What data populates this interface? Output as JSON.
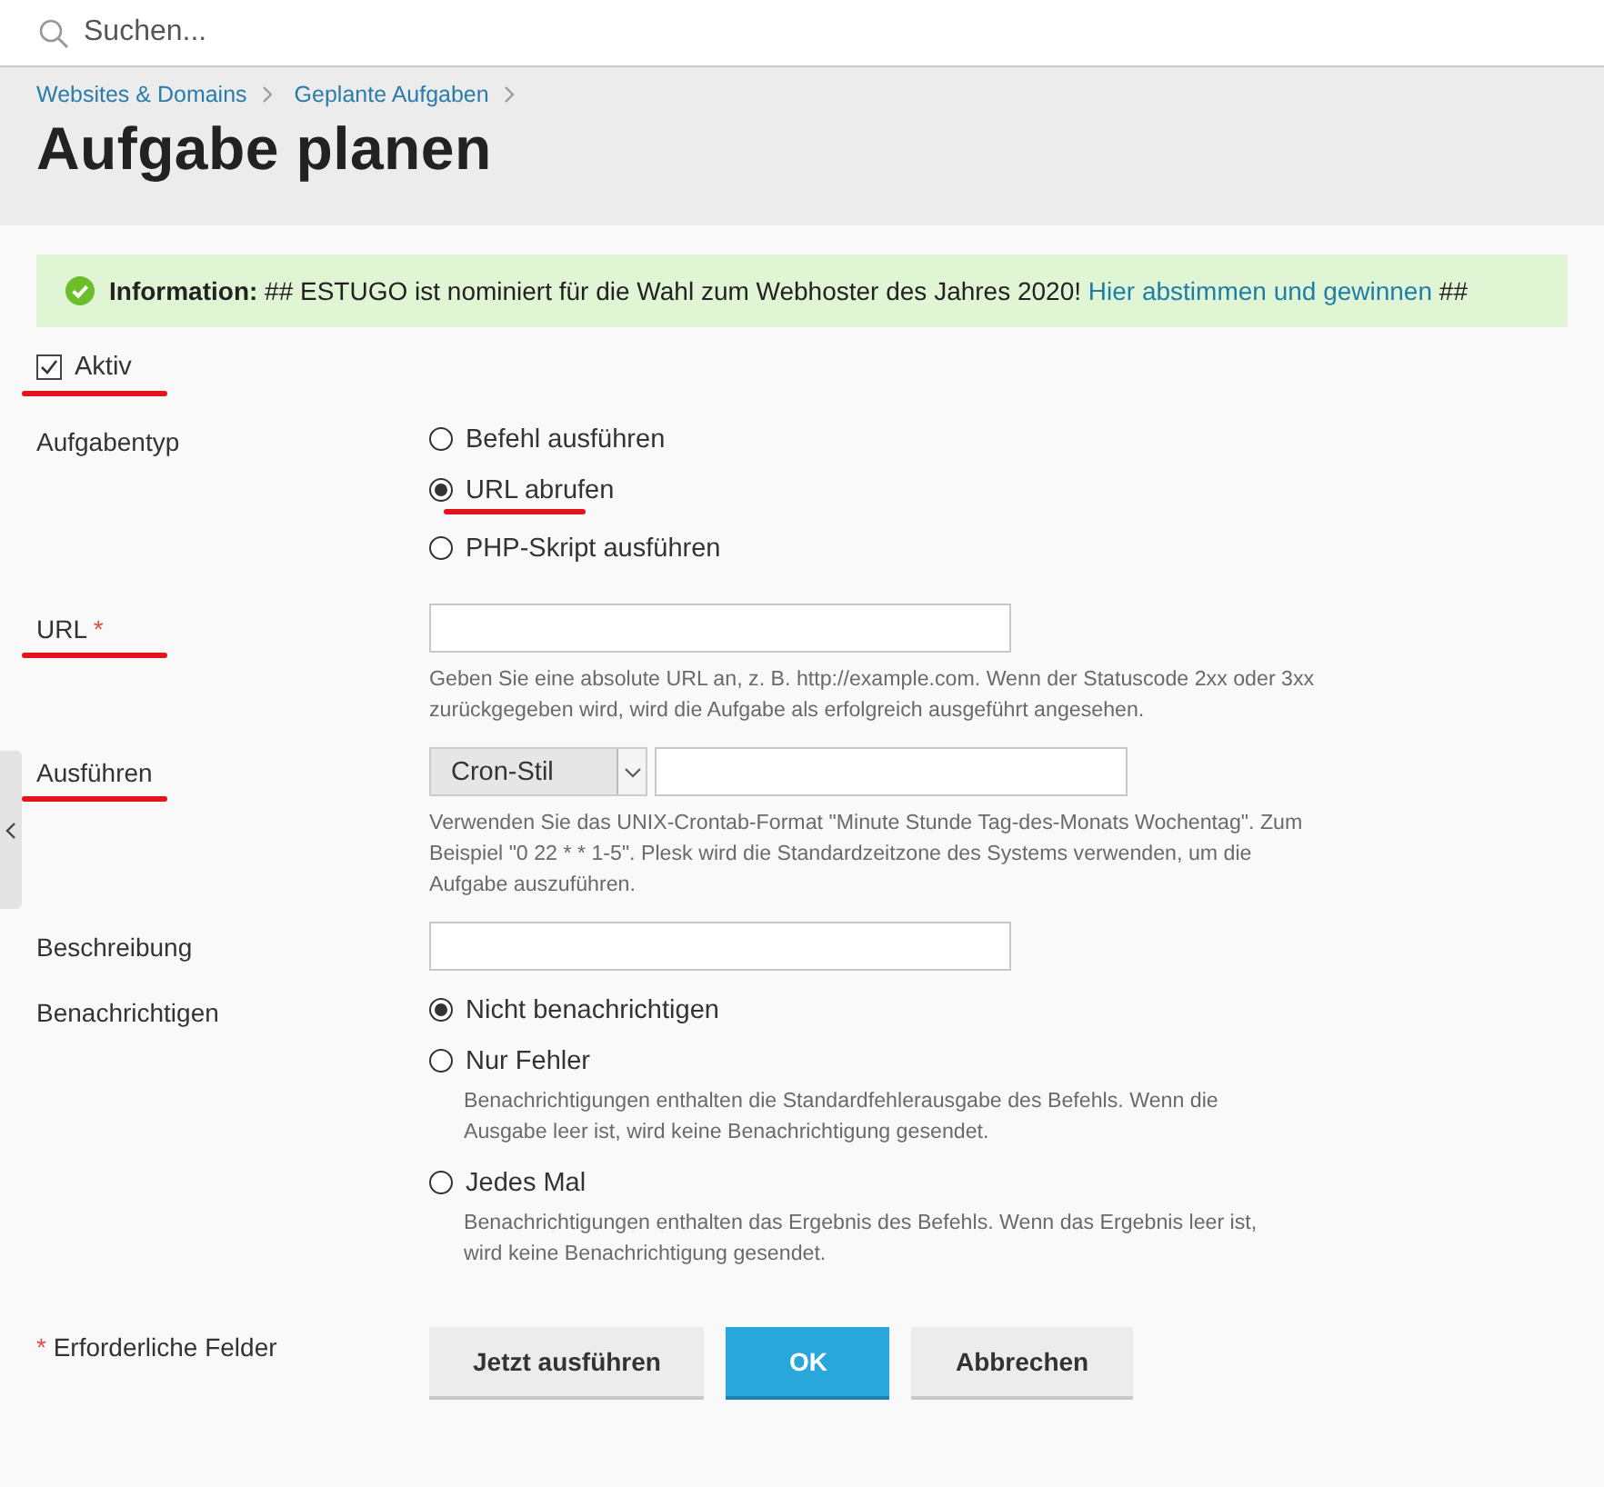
{
  "search": {
    "placeholder": "Suchen..."
  },
  "breadcrumbs": [
    "Websites & Domains",
    "Geplante Aufgaben"
  ],
  "title": "Aufgabe planen",
  "notice": {
    "label": "Information:",
    "text": "## ESTUGO ist nominiert für die Wahl zum Webhoster des Jahres 2020!",
    "link": "Hier abstimmen und gewinnen",
    "suffix": "##"
  },
  "active": {
    "label": "Aktiv",
    "checked": true,
    "underlined": true
  },
  "fields": [
    {
      "kind": "radio",
      "label": "Aufgabentyp",
      "underlined": false,
      "options": [
        {
          "label": "Befehl ausführen",
          "selected": false,
          "underlined": false
        },
        {
          "label": "URL abrufen",
          "selected": true,
          "underlined": true
        },
        {
          "label": "PHP-Skript ausführen",
          "selected": false,
          "underlined": false
        }
      ]
    },
    {
      "kind": "text",
      "label": "URL",
      "required_mark": "*",
      "underlined": true,
      "hint": "Geben Sie eine absolute URL an, z. B. http://example.com. Wenn der Statuscode 2xx oder 3xx zurückgegeben wird, wird die Aufgabe als erfolgreich ausgeführt angesehen."
    },
    {
      "kind": "schedule",
      "label": "Ausführen",
      "underlined": true,
      "select": "Cron-Stil",
      "hint": "Verwenden Sie das UNIX-Crontab-Format \"Minute Stunde Tag-des-Monats Wochentag\". Zum Beispiel \"0 22 * * 1-5\". Plesk wird die Standardzeitzone des Systems verwenden, um die Aufgabe auszuführen."
    },
    {
      "kind": "text",
      "label": "Beschreibung",
      "underlined": false
    },
    {
      "kind": "radio",
      "label": "Benachrichtigen",
      "underlined": false,
      "options": [
        {
          "label": "Nicht benachrichtigen",
          "selected": true,
          "underlined": false
        },
        {
          "label": "Nur Fehler",
          "selected": false,
          "underlined": false,
          "hint": "Benachrichtigungen enthalten die Standardfehlerausgabe des Befehls. Wenn die Ausgabe leer ist, wird keine Benachrichtigung gesendet."
        },
        {
          "label": "Jedes Mal",
          "selected": false,
          "underlined": false,
          "hint": "Benachrichtigungen enthalten das Ergebnis des Befehls. Wenn das Ergebnis leer ist, wird keine Benachrichtigung gesendet."
        }
      ]
    }
  ],
  "required_note": {
    "mark": "*",
    "text": "Erforderliche Felder"
  },
  "buttons": [
    {
      "label": "Jetzt ausführen",
      "primary": false
    },
    {
      "label": "OK",
      "primary": true
    },
    {
      "label": "Abbrechen",
      "primary": false
    }
  ]
}
